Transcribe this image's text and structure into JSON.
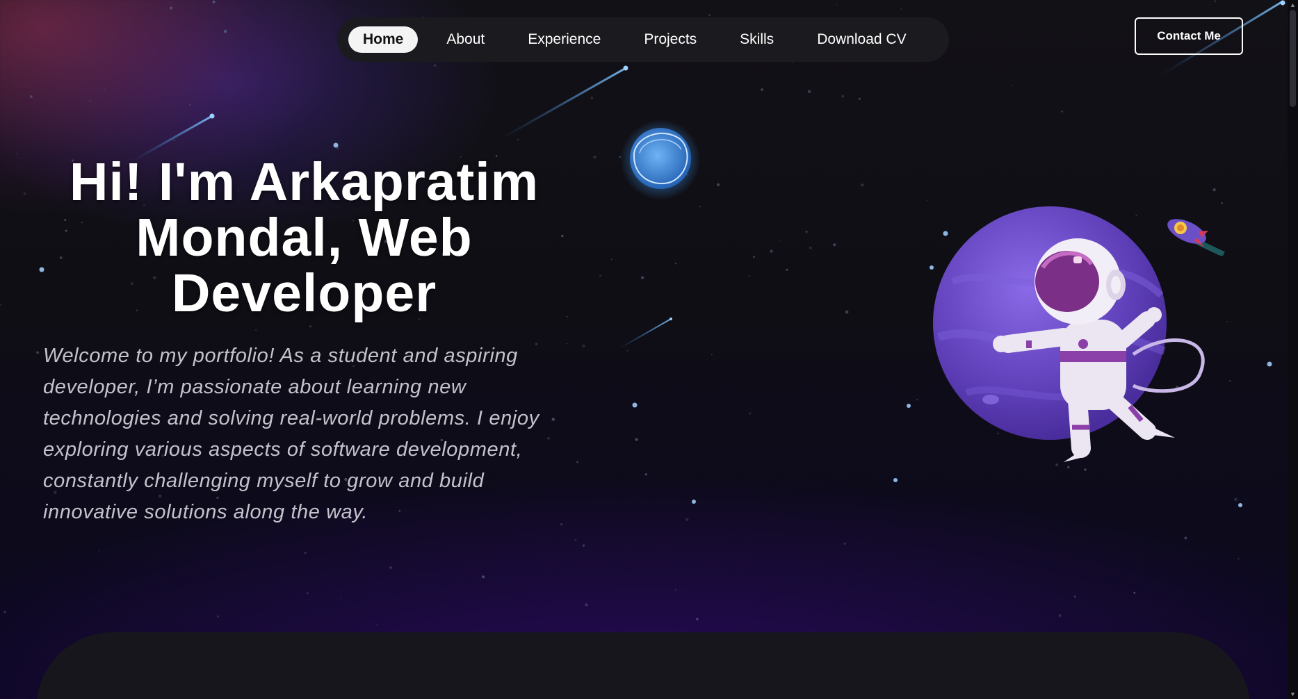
{
  "nav": {
    "items": [
      {
        "label": "Home",
        "active": true
      },
      {
        "label": "About",
        "active": false
      },
      {
        "label": "Experience",
        "active": false
      },
      {
        "label": "Projects",
        "active": false
      },
      {
        "label": "Skills",
        "active": false
      },
      {
        "label": "Download CV",
        "active": false
      }
    ],
    "contact_label": "Contact Me"
  },
  "hero": {
    "title_line1": "Hi! I'm Arkapratim",
    "title_line2": "Mondal, Web",
    "title_line3": "Developer",
    "description": "Welcome to my portfolio! As a student and aspiring developer, I’m passionate about learning new technologies and solving real-world problems. I enjoy exploring various aspects of software development, constantly challenging myself to grow and build innovative solutions along the way."
  },
  "icons": {
    "scroll_up": "scroll-up-arrow-icon",
    "scroll_down": "scroll-down-arrow-icon"
  },
  "colors": {
    "accent_purple": "#6a4fc7",
    "planet_blue": "#3b8ee0",
    "text_white": "#ffffff",
    "text_muted": "#c4c3cc",
    "nav_bg": "#1b1b1f"
  }
}
